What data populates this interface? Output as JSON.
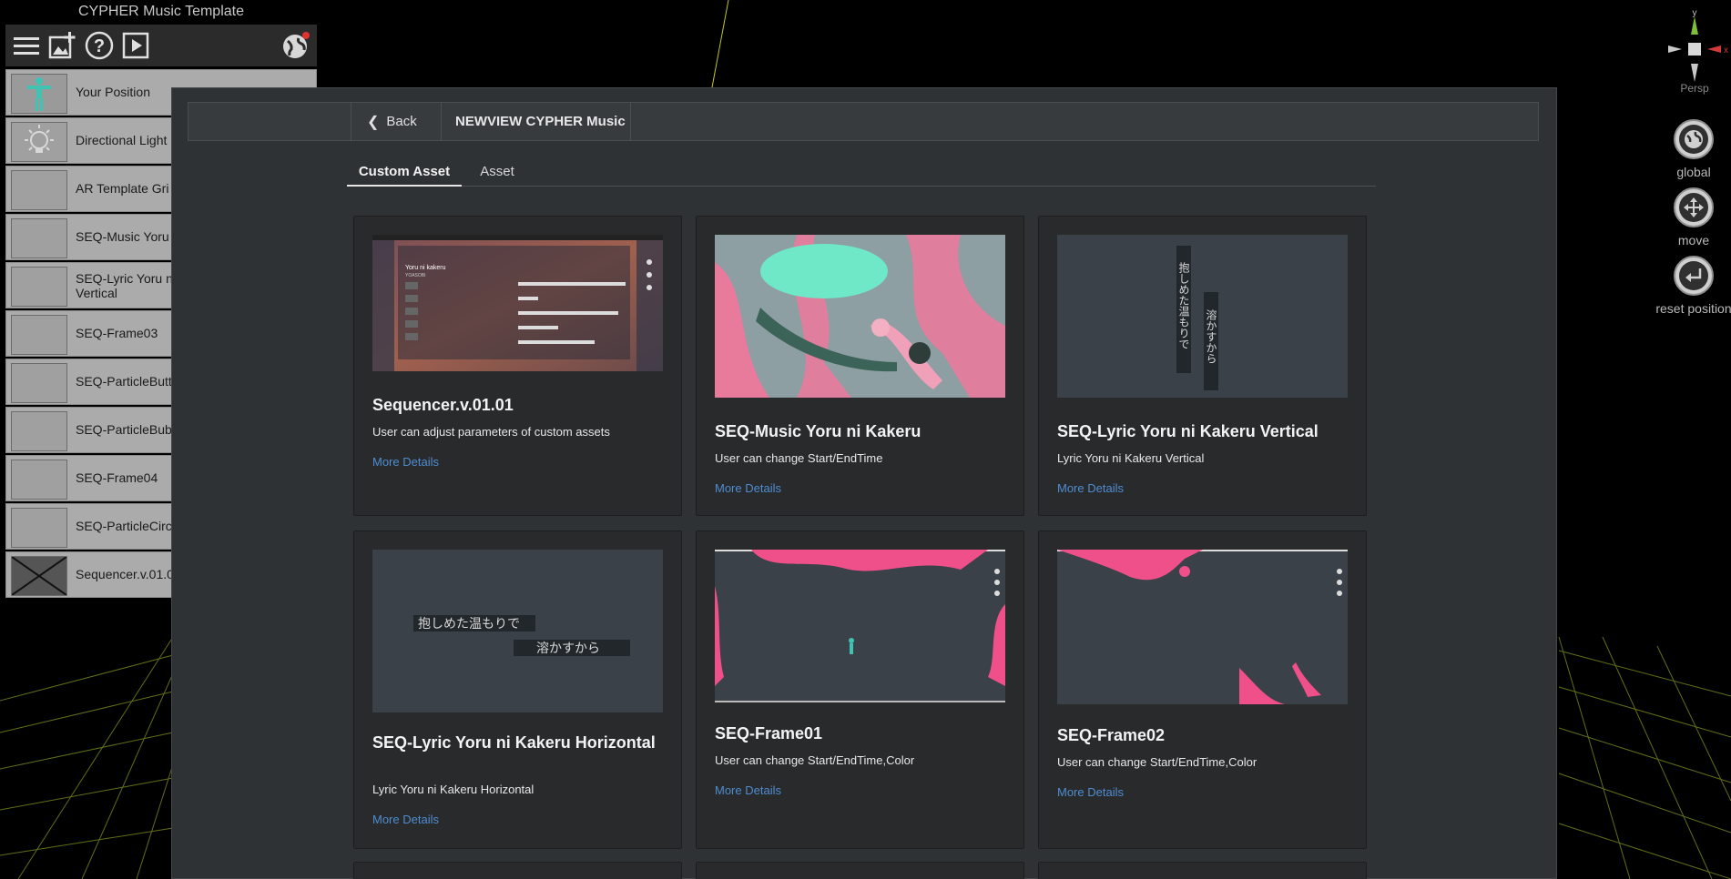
{
  "hierarchy": {
    "title": "CYPHER Music Template",
    "items": [
      {
        "label": "Your Position"
      },
      {
        "label": "Directional Light"
      },
      {
        "label": "AR Template Gri"
      },
      {
        "label": "SEQ-Music Yoru"
      },
      {
        "label": "SEQ-Lyric Yoru ni Vertical"
      },
      {
        "label": "SEQ-Frame03"
      },
      {
        "label": "SEQ-ParticleButt"
      },
      {
        "label": "SEQ-ParticleBubl"
      },
      {
        "label": "SEQ-Frame04"
      },
      {
        "label": "SEQ-ParticleCircl"
      },
      {
        "label": "Sequencer.v.01.0"
      }
    ]
  },
  "gizmo": {
    "y": "y",
    "x": "x",
    "label": "Persp"
  },
  "tools": [
    {
      "label": "global",
      "icon": "globe-icon"
    },
    {
      "label": "move",
      "icon": "move-arrows-icon"
    },
    {
      "label": "reset position",
      "icon": "reset-icon"
    }
  ],
  "modal": {
    "back_label": "Back",
    "title": "NEWVIEW CYPHER Music",
    "tabs": [
      {
        "label": "Custom Asset",
        "active": true
      },
      {
        "label": "Asset",
        "active": false
      }
    ],
    "cards": [
      {
        "title": "Sequencer.v.01.01",
        "desc": "User can adjust parameters of custom assets",
        "link": "More Details",
        "thumb_text": {
          "heading": "Yoru ni kakeru",
          "sub": "YOASOBI"
        }
      },
      {
        "title": "SEQ-Music Yoru ni Kakeru",
        "desc": "User can change Start/EndTime",
        "link": "More Details"
      },
      {
        "title": "SEQ-Lyric Yoru ni Kakeru Vertical",
        "desc": "Lyric Yoru ni Kakeru Vertical",
        "link": "More Details",
        "thumb_text": {
          "line1": "抱しめた温もりで",
          "line2": "溶かすから"
        }
      },
      {
        "title": "SEQ-Lyric Yoru ni Kakeru Horizontal",
        "desc": "Lyric Yoru ni Kakeru Horizontal",
        "link": "More Details",
        "thumb_text": {
          "line1": "抱しめた温もりで",
          "line2": "溶かすから"
        }
      },
      {
        "title": "SEQ-Frame01",
        "desc": "User can change Start/EndTime,Color",
        "link": "More Details"
      },
      {
        "title": "SEQ-Frame02",
        "desc": "User can change Start/EndTime,Color",
        "link": "More Details"
      }
    ]
  },
  "colors": {
    "accent_link": "#4f8dd0",
    "pink": "#f0508a",
    "teal": "#5fd3c0"
  }
}
